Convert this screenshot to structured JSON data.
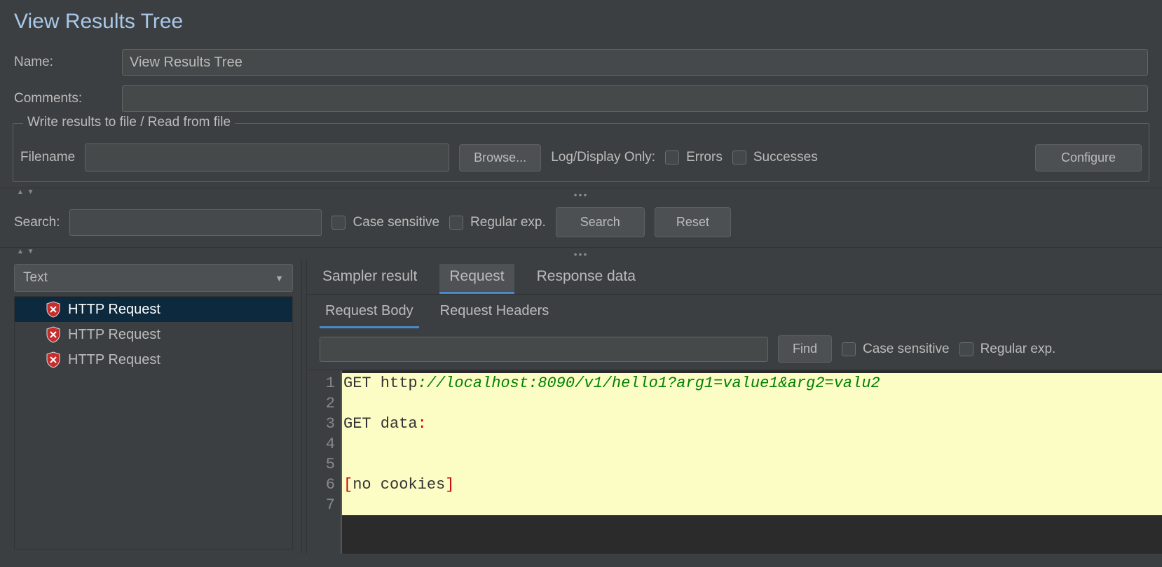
{
  "title": "View Results Tree",
  "nameLabel": "Name:",
  "nameValue": "View Results Tree",
  "commentsLabel": "Comments:",
  "commentsValue": "",
  "group": {
    "title": "Write results to file / Read from file",
    "filenameLabel": "Filename",
    "filenameValue": "",
    "browse": "Browse...",
    "logDisplay": "Log/Display Only:",
    "errors": "Errors",
    "successes": "Successes",
    "configure": "Configure"
  },
  "searchBar": {
    "label": "Search:",
    "caseSensitive": "Case sensitive",
    "regex": "Regular exp.",
    "searchBtn": "Search",
    "resetBtn": "Reset"
  },
  "renderer": "Text",
  "tree": [
    "HTTP Request",
    "HTTP Request",
    "HTTP Request"
  ],
  "treeSelected": 0,
  "tabs": {
    "sampler": "Sampler result",
    "request": "Request",
    "response": "Response data"
  },
  "subtabs": {
    "body": "Request Body",
    "headers": "Request Headers"
  },
  "findBar": {
    "find": "Find",
    "caseSensitive": "Case sensitive",
    "regex": "Regular exp."
  },
  "code": {
    "line1_a": "GET http",
    "line1_b": "://localhost:8090/v1/hello1?arg1=value1&arg2=valu2",
    "line3_a": "GET data",
    "line3_b": ":",
    "line6_a": "[",
    "line6_b": "no cookies",
    "line6_c": "]"
  },
  "gutter": [
    "1",
    "2",
    "3",
    "4",
    "5",
    "6",
    "7"
  ]
}
